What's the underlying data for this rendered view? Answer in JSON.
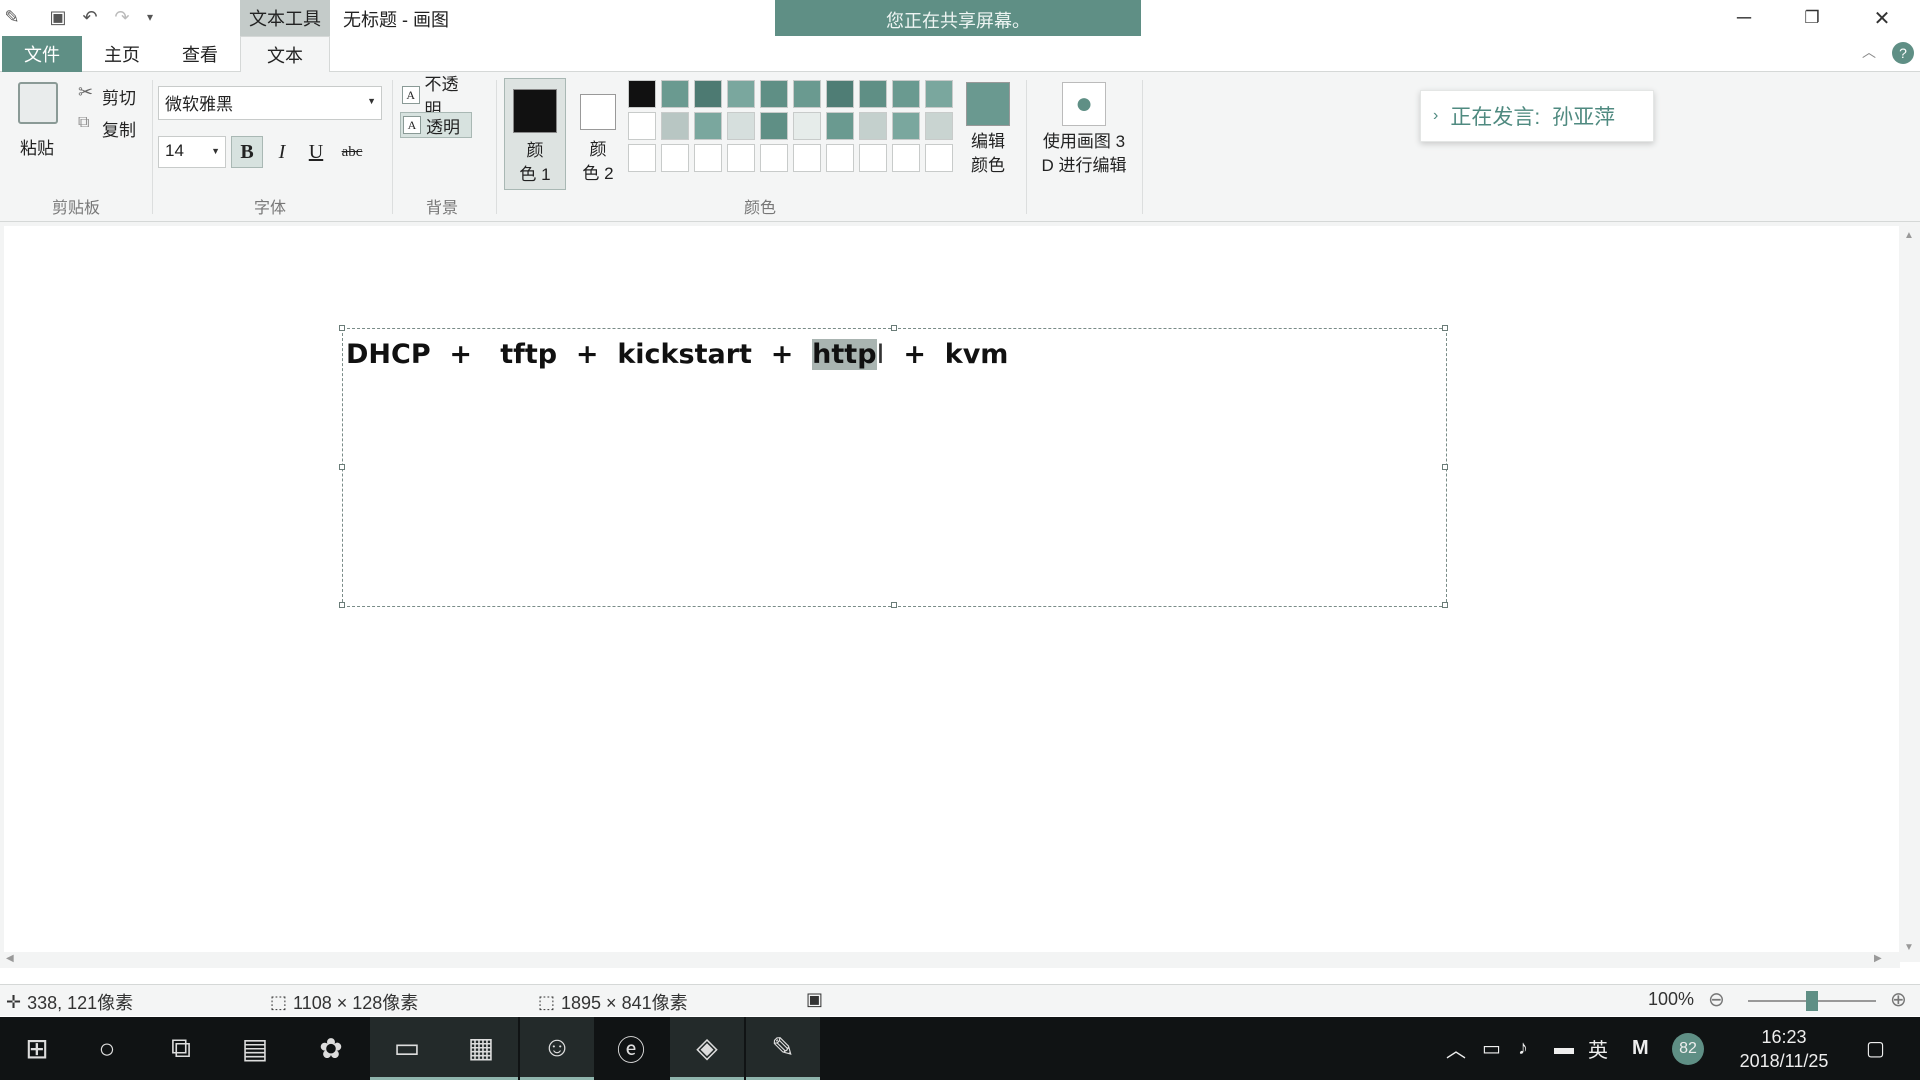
{
  "titlebar": {
    "context_tab": "文本工具",
    "doc_title": "无标题 - 画图",
    "share_banner": "您正在共享屏幕。"
  },
  "tabs": {
    "file": "文件",
    "home": "主页",
    "view": "查看",
    "text": "文本"
  },
  "ribbon": {
    "clipboard": {
      "paste": "粘贴",
      "cut": "剪切",
      "copy": "复制",
      "label": "剪贴板"
    },
    "font": {
      "name": "微软雅黑",
      "size": "14",
      "bold": "B",
      "italic": "I",
      "underline": "U",
      "strike": "abc",
      "label": "字体"
    },
    "background": {
      "opaque": "不透明",
      "transparent": "透明",
      "label": "背景"
    },
    "colors": {
      "color1_line1": "颜",
      "color1_line2": "色 1",
      "color2_line1": "颜",
      "color2_line2": "色 2",
      "edit_line1": "编辑",
      "edit_line2": "颜色",
      "paint3d_line1": "使用画图 3",
      "paint3d_line2": "D 进行编辑",
      "label": "颜色",
      "palette": [
        "#111111",
        "#6a9a90",
        "#4d7a72",
        "#7aa79e",
        "#5f8f85",
        "#6a9a90",
        "#4f7d75",
        "#5f8f85",
        "#6a9a90",
        "#7aa79e",
        "#ffffff",
        "#b8c6c3",
        "#7aa79e",
        "#d6dfdd",
        "#5f8f85",
        "#e6ecea",
        "#6a9a90",
        "#c4d0cd",
        "#7aa79e",
        "#c9d4d1",
        "#ffffff",
        "#ffffff",
        "#ffffff",
        "#ffffff",
        "#ffffff",
        "#ffffff",
        "#ffffff",
        "#ffffff",
        "#ffffff",
        "#ffffff"
      ]
    },
    "speaker": {
      "prefix": "正在发言:",
      "name": "孙亚萍"
    }
  },
  "canvas": {
    "text_before": "DHCP  +   tftp  +  kickstart  +  ",
    "text_selected": "http",
    "text_after": "  +  kvm"
  },
  "statusbar": {
    "cursor_pos": "338, 121像素",
    "selection_size": "1108 × 128像素",
    "image_size": "1895 × 841像素",
    "zoom": "100%"
  },
  "taskbar": {
    "ime": "英",
    "ime_mode": "M",
    "badge": "82",
    "time": "16:23",
    "date": "2018/11/25"
  }
}
